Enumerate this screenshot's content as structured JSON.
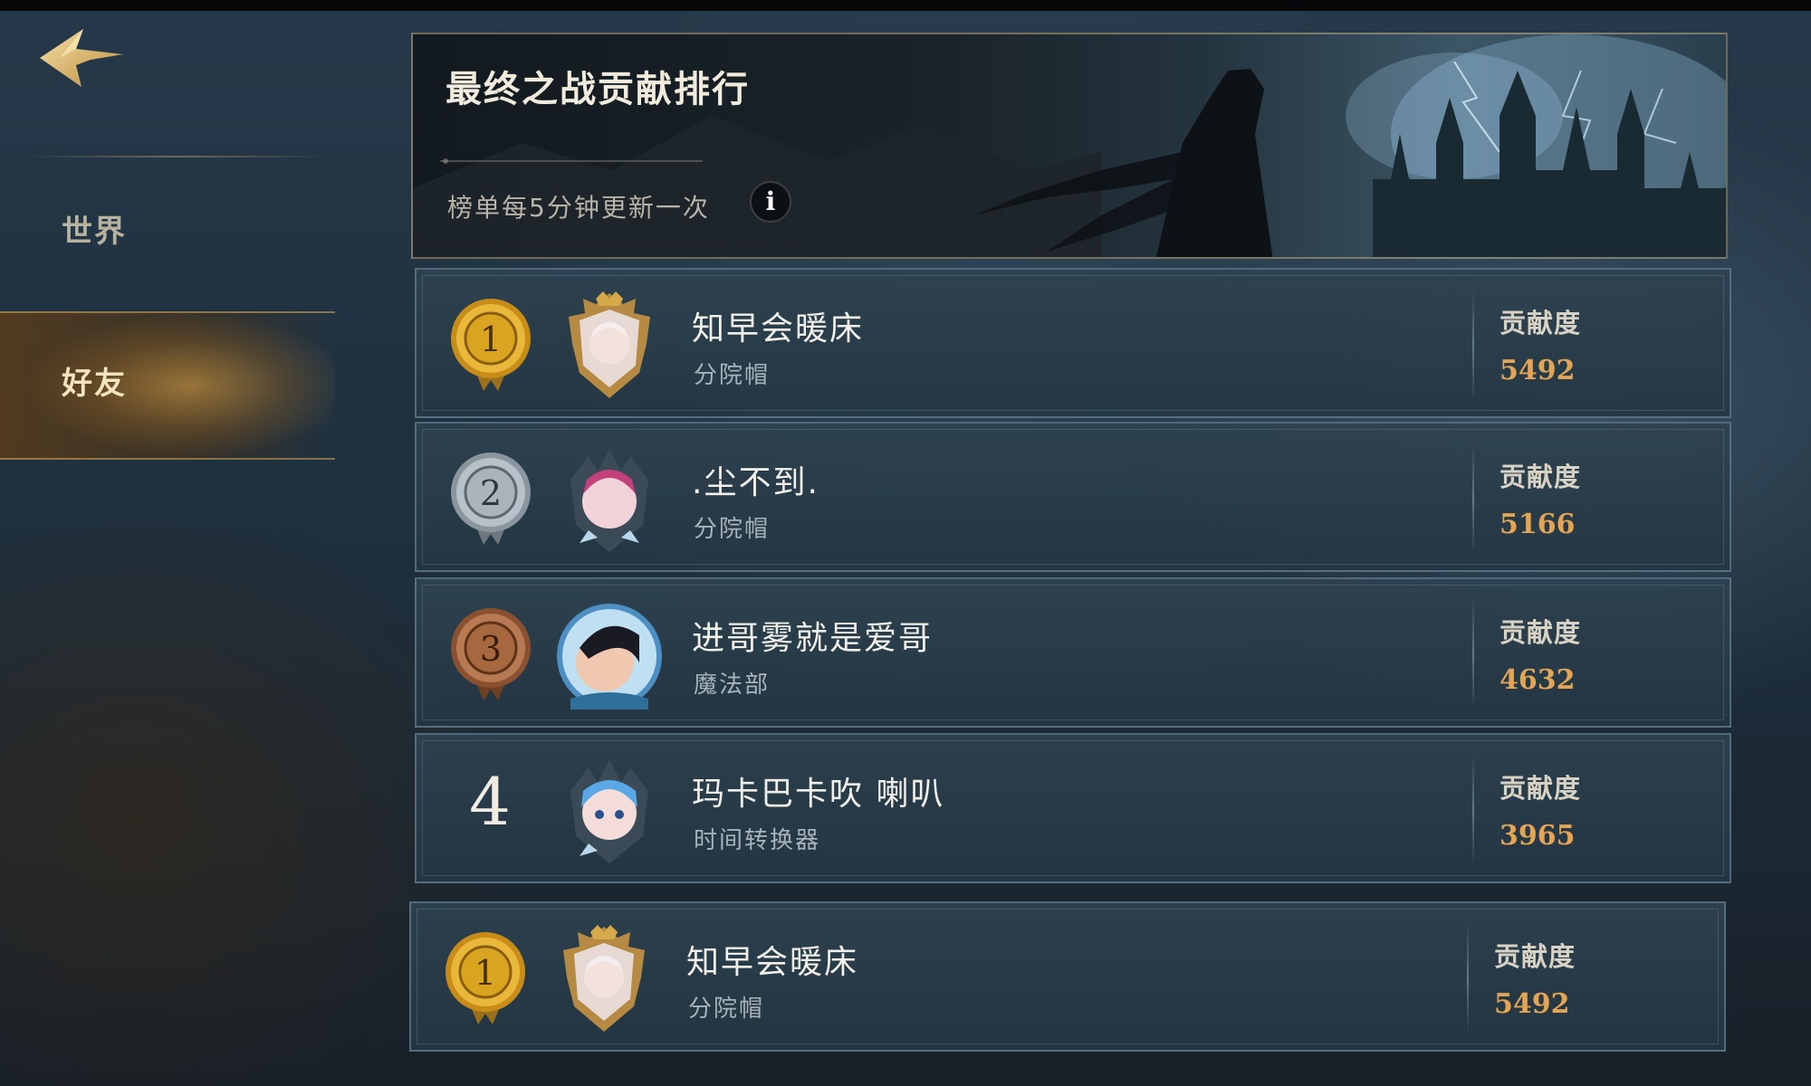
{
  "sidebar": {
    "tabs": [
      {
        "label": "世界",
        "active": false
      },
      {
        "label": "好友",
        "active": true
      }
    ]
  },
  "banner": {
    "title": "最终之战贡献排行",
    "subtitle": "榜单每5分钟更新一次",
    "info_icon": "i"
  },
  "score_label": "贡献度",
  "leaderboard": [
    {
      "rank": "1",
      "medal": "gold",
      "name": "知早会暖床",
      "house": "分院帽",
      "score": "5492"
    },
    {
      "rank": "2",
      "medal": "silver",
      "name": ".尘不到.",
      "house": "分院帽",
      "score": "5166"
    },
    {
      "rank": "3",
      "medal": "bronze",
      "name": "进哥雾就是爱哥",
      "house": "魔法部",
      "score": "4632"
    },
    {
      "rank": "4",
      "medal": "none",
      "name": "玛卡巴卡吹 喇叭",
      "house": "时间转换器",
      "score": "3965"
    }
  ],
  "self_entry": {
    "rank": "1",
    "medal": "gold",
    "name": "知早会暖床",
    "house": "分院帽",
    "score": "5492"
  },
  "colors": {
    "score": "#e3a553",
    "gold": "#d9a520",
    "silver": "#a9b4bd",
    "bronze": "#a8683f"
  }
}
